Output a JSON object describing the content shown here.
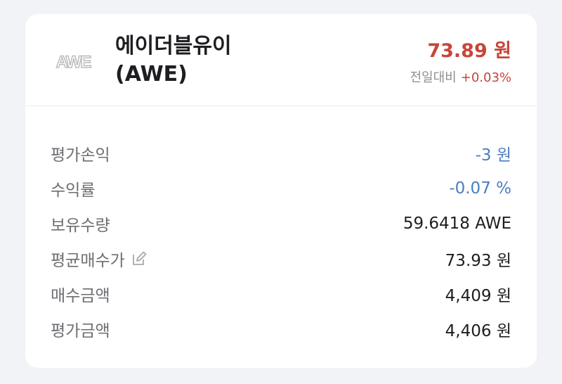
{
  "asset": {
    "logo_text": "AWE",
    "name_line1": "에이더블유이",
    "name_line2": "(AWE)",
    "price": "73.89 원",
    "change_label": "전일대비",
    "change_value": "+0.03%"
  },
  "colors": {
    "up": "#c8453a",
    "down": "#4a7fc1",
    "label": "#6e6e73"
  },
  "details": [
    {
      "label": "평가손익",
      "value": "-3 원",
      "tone": "down"
    },
    {
      "label": "수익률",
      "value": "-0.07 %",
      "tone": "down"
    },
    {
      "label": "보유수량",
      "value": "59.6418 AWE",
      "tone": "normal"
    },
    {
      "label": "평균매수가",
      "value": "73.93 원",
      "tone": "normal",
      "icon": "edit-icon"
    },
    {
      "label": "매수금액",
      "value": "4,409 원",
      "tone": "normal"
    },
    {
      "label": "평가금액",
      "value": "4,406 원",
      "tone": "normal"
    }
  ]
}
